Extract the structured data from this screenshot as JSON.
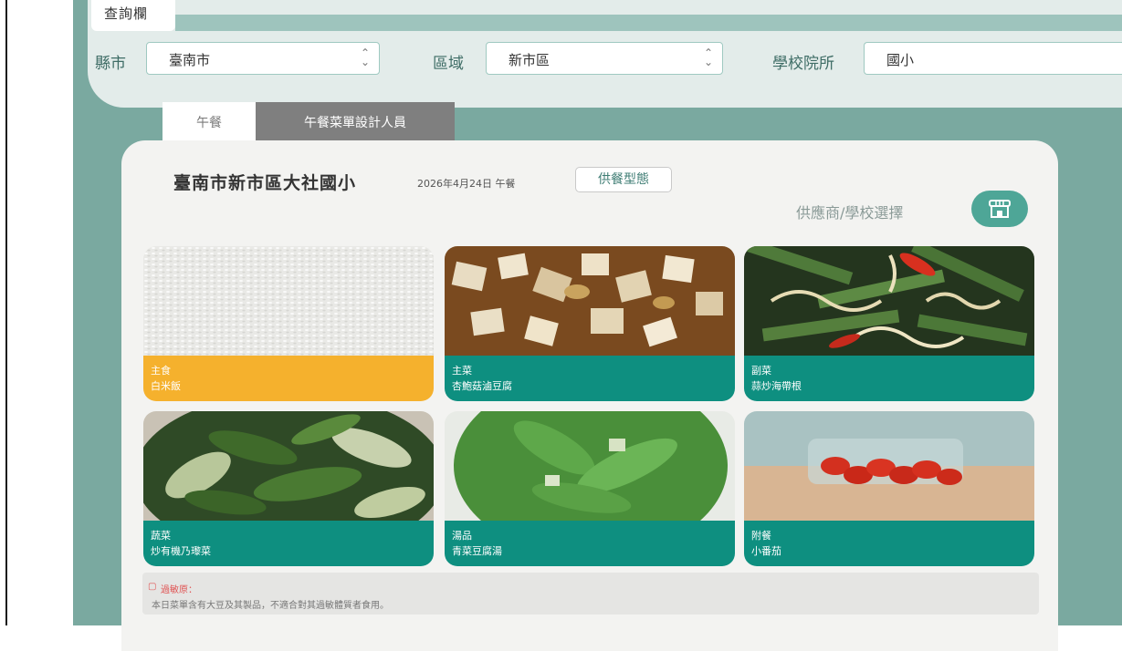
{
  "query": {
    "tab_label": "查詢欄",
    "county_label": "縣市",
    "county_value": "臺南市",
    "area_label": "區域",
    "area_value": "新市區",
    "school_label": "學校院所",
    "school_value": "國小"
  },
  "tabs": [
    {
      "label": "午餐"
    },
    {
      "label": "午餐菜單設計人員"
    }
  ],
  "menu": {
    "school_name": "臺南市新市區大社國小",
    "date": "2026年4月24日 午餐",
    "meal_type_button": "供餐型態",
    "supplier_link": "供應商/學校選擇",
    "supplier_icon": "shop-icon"
  },
  "dishes": [
    {
      "category": "主食",
      "name": "白米飯"
    },
    {
      "category": "主菜",
      "name": "杏鮑菇滷豆腐"
    },
    {
      "category": "副菜",
      "name": "蒜炒海帶根"
    },
    {
      "category": "蔬菜",
      "name": "炒有機乃瓈菜"
    },
    {
      "category": "湯品",
      "name": "青菜豆腐湯"
    },
    {
      "category": "附餐",
      "name": "小番茄"
    }
  ],
  "allergen": {
    "title": "過敏原：",
    "text": "本日菜單含有大豆及其製品，不適合對其過敏體質者食用。"
  },
  "colors": {
    "teal": "#0e8f80",
    "staple": "#f5b12d",
    "background_teal": "#7aa9a0"
  }
}
